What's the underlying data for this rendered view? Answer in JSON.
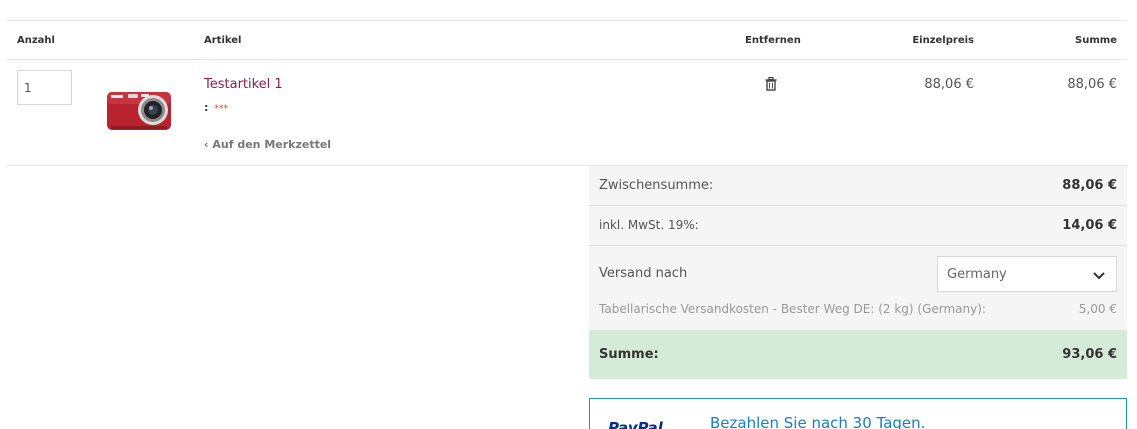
{
  "table": {
    "headers": {
      "quantity": "Anzahl",
      "article": "Artikel",
      "remove": "Entfernen",
      "unit_price": "Einzelpreis",
      "sum": "Summe"
    },
    "item": {
      "quantity": "1",
      "name": "Testartikel 1",
      "attr_colon": ":",
      "attr_value": "***",
      "wishlist_link": "‹ Auf den Merkzettel",
      "unit_price": "88,06 €",
      "line_total": "88,06 €",
      "image_icon": "camera-product-image",
      "remove_icon": "trash-icon"
    }
  },
  "totals": {
    "subtotal_label": "Zwischensumme:",
    "subtotal_value": "88,06 €",
    "tax_label": "inkl. MwSt. 19%:",
    "tax_value": "14,06 €",
    "shipping_label": "Versand nach",
    "shipping_country": "Germany",
    "shipping_desc": "Tabellarische Versandkosten - Bester Weg DE: (2 kg) (Germany):",
    "shipping_cost": "5,00 €",
    "total_label": "Summe:",
    "total_value": "93,06 €"
  },
  "paypal": {
    "logo_text": "PayPal",
    "promo_text": "Bezahlen Sie nach 30 Tagen."
  },
  "colors": {
    "product_link": "#8a1e5a",
    "total_row_bg": "#d4ebd8",
    "paypal_border": "#1a9ab0"
  }
}
